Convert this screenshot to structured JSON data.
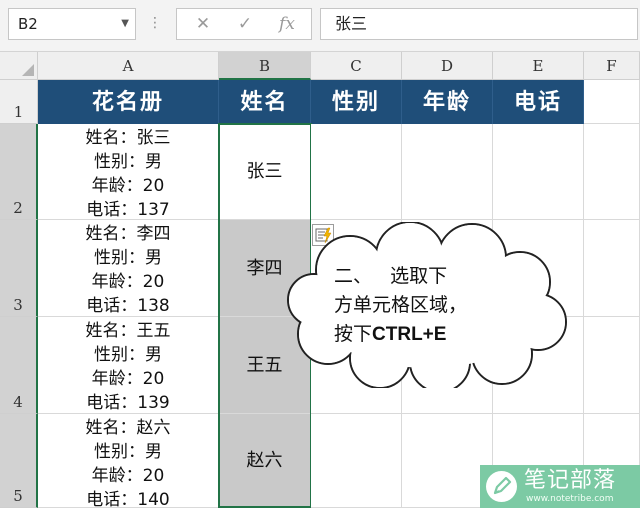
{
  "formula_bar": {
    "name_box": "B2",
    "cancel_icon": "✕",
    "enter_icon": "✓",
    "fx_icon": "fx",
    "formula": "张三"
  },
  "columns": [
    "A",
    "B",
    "C",
    "D",
    "E",
    "F"
  ],
  "selected_column": "B",
  "rows": [
    "1",
    "2",
    "3",
    "4",
    "5"
  ],
  "header_row": [
    "花名册",
    "姓名",
    "性别",
    "年龄",
    "电话"
  ],
  "roster": [
    [
      "姓名：张三",
      "性别：男",
      "年龄：20",
      "电话：137"
    ],
    [
      "姓名：李四",
      "性别：男",
      "年龄：20",
      "电话：138"
    ],
    [
      "姓名：王五",
      "性别：男",
      "年龄：20",
      "电话：139"
    ],
    [
      "姓名：赵六",
      "性别：男",
      "年龄：20",
      "电话：140"
    ]
  ],
  "names": [
    "张三",
    "李四",
    "王五",
    "赵六"
  ],
  "callout": {
    "line1": "二、   选取下",
    "line2": "方单元格区域，",
    "line3_prefix": "按下",
    "line3_key": "CTRL+E"
  },
  "watermark": {
    "title": "笔记部落",
    "url": "www.notetribe.com"
  },
  "colors": {
    "header_fill": "#1f4e79",
    "selection_green": "#217346",
    "selected_fill": "#c9c9c9",
    "watermark": "#7ccaa4"
  }
}
